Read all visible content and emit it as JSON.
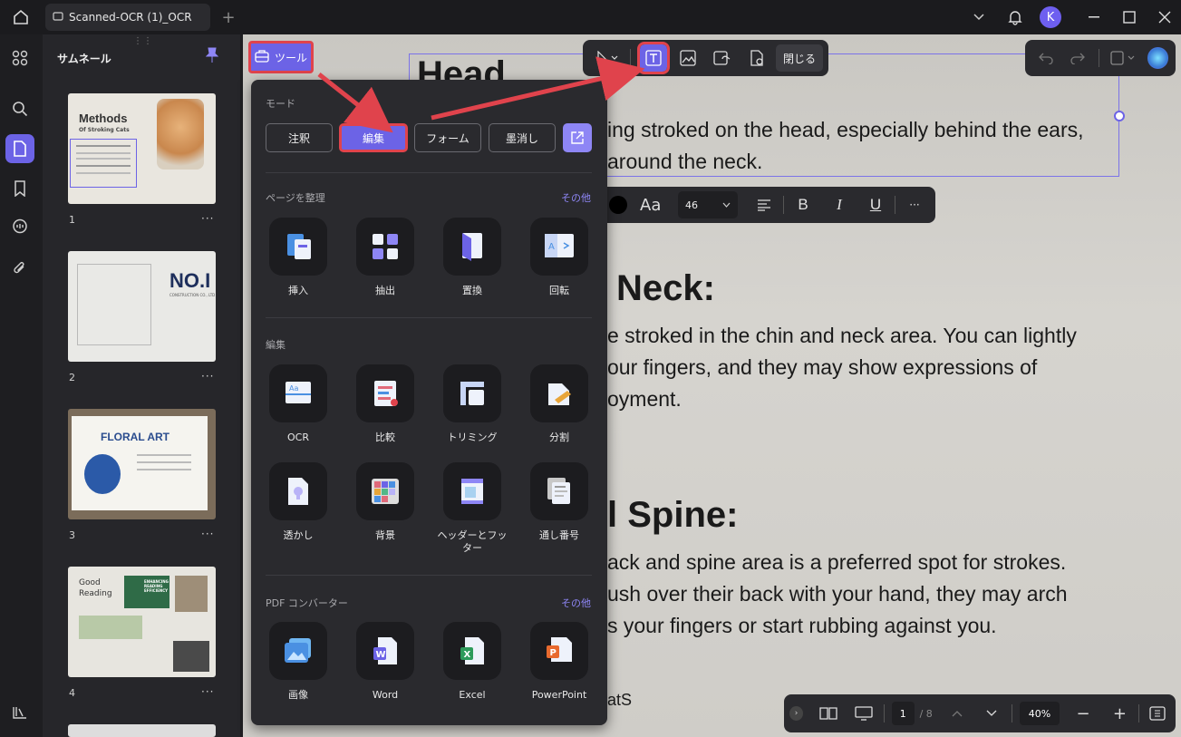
{
  "titlebar": {
    "tab_title": "Scanned-OCR (1)_OCR",
    "avatar_letter": "K"
  },
  "thumbnails": {
    "title": "サムネール",
    "pages": [
      {
        "number": "1",
        "heading": "Methods",
        "subheading": "Of Stroking Cats"
      },
      {
        "number": "2",
        "heading": "NO.I",
        "subheading": "CONSTRUCTION CO., LTD"
      },
      {
        "number": "3",
        "heading": "FLORAL ART",
        "subheading": ""
      },
      {
        "number": "4",
        "heading": "Good Reading",
        "subheading": "ENHANCING READING EFFICIENCY"
      }
    ],
    "more": "···"
  },
  "tools_button": {
    "label": "ツール"
  },
  "tools_panel": {
    "mode_label": "モード",
    "modes": [
      "注釈",
      "編集",
      "フォーム",
      "墨消し"
    ],
    "organize_label": "ページを整理",
    "organize_more": "その他",
    "organize_tools": [
      "挿入",
      "抽出",
      "置換",
      "回転"
    ],
    "edit_label": "編集",
    "edit_tools": [
      "OCR",
      "比較",
      "トリミング",
      "分割",
      "透かし",
      "背景",
      "ヘッダーとフッター",
      "通し番号"
    ],
    "converter_label": "PDF コンバーター",
    "converter_more": "その他",
    "converter_tools": [
      "画像",
      "Word",
      "Excel",
      "PowerPoint"
    ]
  },
  "edit_toolbar": {
    "close_label": "閉じる"
  },
  "format_toolbar": {
    "font_label": "Aa",
    "font_size": "46"
  },
  "document": {
    "heading1_partial": "Head",
    "para1_line1": "ing stroked on the head, especially behind the ears,",
    "para1_line2": "around the neck.",
    "heading2_partial": "Neck:",
    "para2_line1": "e stroked in the chin and neck area. You can lightly",
    "para2_line2": "our fingers, and they may show expressions of",
    "para2_line3": "oyment.",
    "heading3_partial": "l Spine:",
    "para3_line1": "ack and spine area is a preferred spot for strokes.",
    "para3_line2": "ush over their back with your hand, they may arch",
    "para3_line3": "s your fingers or start rubbing against you.",
    "footer_partial": "atS"
  },
  "bottombar": {
    "page_current": "1",
    "page_total": "/ 8",
    "zoom": "40%"
  },
  "colors": {
    "accent": "#6c63e6",
    "highlight_red": "#e0434c"
  }
}
